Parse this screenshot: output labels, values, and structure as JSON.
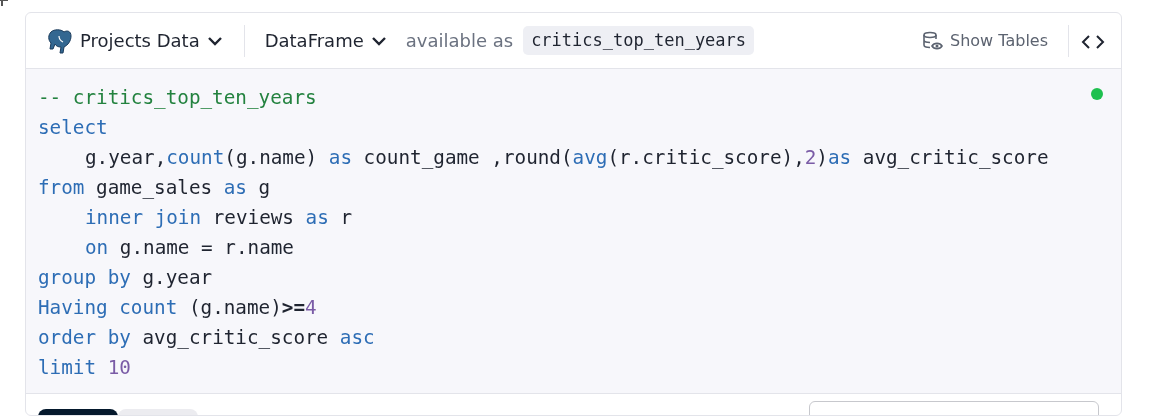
{
  "source": {
    "label": "Projects Data"
  },
  "output": {
    "label": "DataFrame",
    "available_text": "available as",
    "variable": "critics_top_ten_years"
  },
  "toolbar": {
    "show_tables": "Show Tables"
  },
  "status_dot": {
    "color": "#1ec04f"
  },
  "code_lines": [
    {
      "indented": false,
      "tokens": [
        {
          "kind": "comment",
          "text": "-- critics_top_ten_years"
        }
      ]
    },
    {
      "indented": false,
      "tokens": [
        {
          "kind": "keyword",
          "text": "select"
        }
      ]
    },
    {
      "indented": true,
      "tokens": [
        {
          "kind": "plain",
          "text": "g.year,"
        },
        {
          "kind": "keyword",
          "text": "count"
        },
        {
          "kind": "plain",
          "text": "(g.name) "
        },
        {
          "kind": "keyword",
          "text": "as"
        },
        {
          "kind": "plain",
          "text": " count_game ,round("
        },
        {
          "kind": "keyword",
          "text": "avg"
        },
        {
          "kind": "plain",
          "text": "(r.critic_score),"
        },
        {
          "kind": "number",
          "text": "2"
        },
        {
          "kind": "plain",
          "text": ")"
        },
        {
          "kind": "keyword",
          "text": "as"
        },
        {
          "kind": "plain",
          "text": " avg_critic_score"
        }
      ]
    },
    {
      "indented": false,
      "tokens": [
        {
          "kind": "keyword",
          "text": "from"
        },
        {
          "kind": "plain",
          "text": " game_sales "
        },
        {
          "kind": "keyword",
          "text": "as"
        },
        {
          "kind": "plain",
          "text": " g"
        }
      ]
    },
    {
      "indented": true,
      "tokens": [
        {
          "kind": "keyword",
          "text": "inner join"
        },
        {
          "kind": "plain",
          "text": " reviews "
        },
        {
          "kind": "keyword",
          "text": "as"
        },
        {
          "kind": "plain",
          "text": " r"
        }
      ]
    },
    {
      "indented": true,
      "tokens": [
        {
          "kind": "keyword",
          "text": "on"
        },
        {
          "kind": "plain",
          "text": " g.name = r.name"
        }
      ]
    },
    {
      "indented": false,
      "tokens": [
        {
          "kind": "keyword",
          "text": "group by"
        },
        {
          "kind": "plain",
          "text": " g.year"
        }
      ]
    },
    {
      "indented": false,
      "tokens": [
        {
          "kind": "keyword",
          "text": "Having count"
        },
        {
          "kind": "plain",
          "text": " (g.name)"
        },
        {
          "kind": "operator",
          "text": ">="
        },
        {
          "kind": "number",
          "text": "4"
        }
      ]
    },
    {
      "indented": false,
      "tokens": [
        {
          "kind": "keyword",
          "text": "order by"
        },
        {
          "kind": "plain",
          "text": " avg_critic_score "
        },
        {
          "kind": "keyword",
          "text": "asc"
        }
      ]
    },
    {
      "indented": false,
      "tokens": [
        {
          "kind": "keyword",
          "text": "limit "
        },
        {
          "kind": "number",
          "text": "10"
        }
      ]
    }
  ],
  "result_tabs": [
    {
      "selected": true
    },
    {
      "selected": false
    }
  ]
}
